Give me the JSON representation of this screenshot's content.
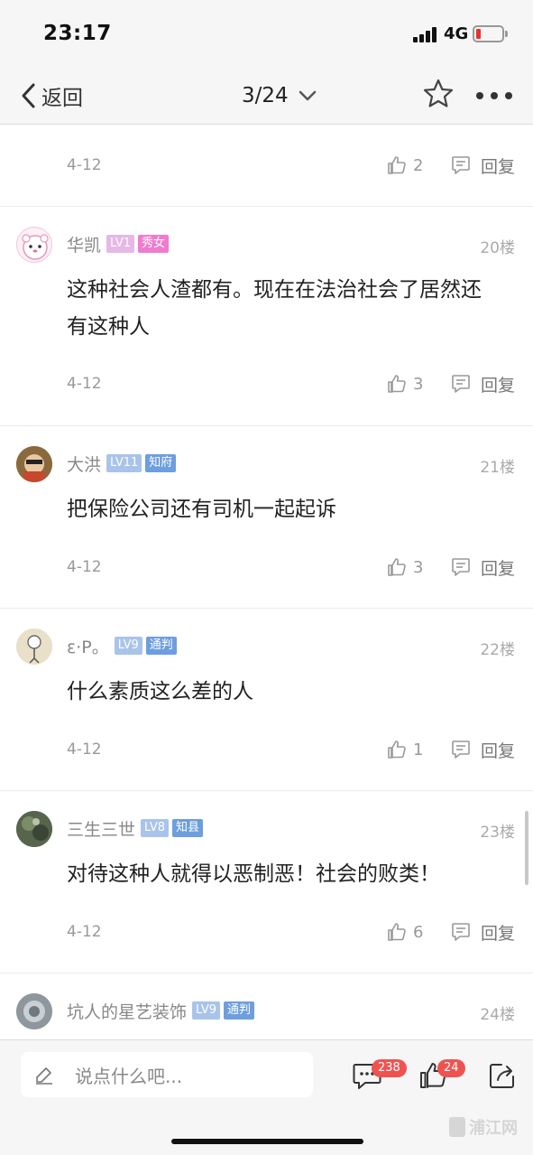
{
  "status_bar": {
    "time": "23:17",
    "network": "4G",
    "battery_level": 0.1,
    "battery_color": "#e5322d"
  },
  "nav": {
    "back_label": "返回",
    "page_indicator": "3/24"
  },
  "comments": [
    {
      "date": "4-12",
      "likes": "2",
      "reply_label": "回复"
    },
    {
      "username": "华凯",
      "level": "LV1",
      "title": "秀女",
      "floor": "20楼",
      "content": "这种社会人渣都有。现在在法治社会了居然还有这种人",
      "date": "4-12",
      "likes": "3",
      "reply_label": "回复",
      "level_color": "#e6b8e6",
      "title_color": "#f07ccf"
    },
    {
      "username": "大洪",
      "level": "LV11",
      "title": "知府",
      "floor": "21楼",
      "content": "把保险公司还有司机一起起诉",
      "date": "4-12",
      "likes": "3",
      "reply_label": "回复",
      "level_color": "#a9c4ea",
      "title_color": "#6d9ede"
    },
    {
      "username": "ε·P。",
      "level": "LV9",
      "title": "通判",
      "floor": "22楼",
      "content": "什么素质这么差的人",
      "date": "4-12",
      "likes": "1",
      "reply_label": "回复",
      "level_color": "#a9c4ea",
      "title_color": "#6d9ede"
    },
    {
      "username": "三生三世",
      "level": "LV8",
      "title": "知县",
      "floor": "23楼",
      "content": "对待这种人就得以恶制恶！社会的败类！",
      "date": "4-12",
      "likes": "6",
      "reply_label": "回复",
      "level_color": "#a9c4ea",
      "title_color": "#6d9ede"
    },
    {
      "username": "坑人的星艺装饰",
      "level": "LV9",
      "title": "通判",
      "floor": "24楼"
    }
  ],
  "bottom_bar": {
    "input_placeholder": "说点什么吧...",
    "comment_count": "238",
    "like_count": "24"
  },
  "watermark": "浦江网"
}
